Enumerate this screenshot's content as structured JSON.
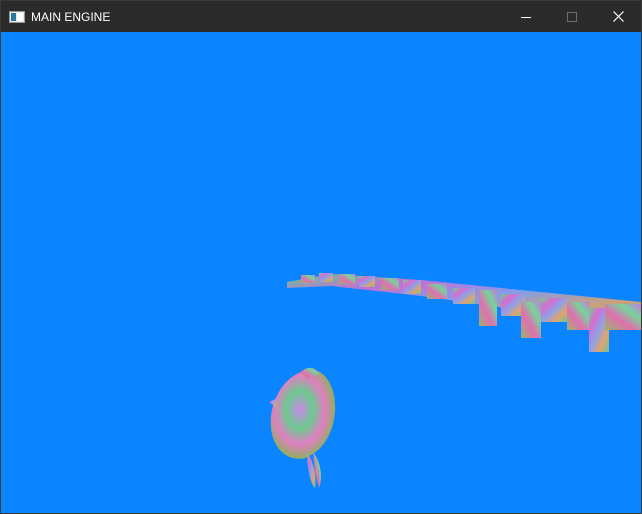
{
  "window": {
    "title": "MAIN ENGINE",
    "app_icon": "console-app-icon",
    "controls": {
      "minimize_icon": "minimize-icon",
      "maximize_icon": "maximize-icon",
      "close_icon": "close-icon"
    }
  },
  "viewport": {
    "background_color": "#0a84ff",
    "objects": [
      "instanced-cube-row",
      "textured-fish-model"
    ]
  },
  "colors": {
    "titlebar": "#2b2b2b",
    "title_text": "#ffffff",
    "clear_color": "#0a84ff"
  }
}
